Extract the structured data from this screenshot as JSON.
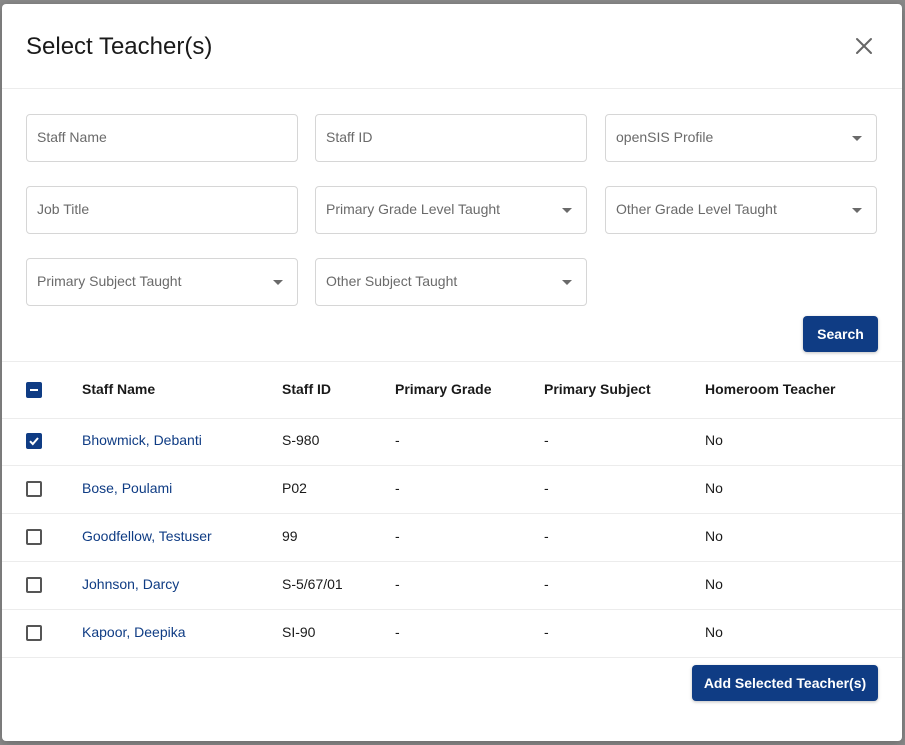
{
  "dialog": {
    "title": "Select Teacher(s)"
  },
  "filters": {
    "staff_name": "Staff Name",
    "staff_id": "Staff ID",
    "opensis_profile": "openSIS Profile",
    "job_title": "Job Title",
    "primary_grade": "Primary Grade Level Taught",
    "other_grade": "Other Grade Level Taught",
    "primary_subject": "Primary Subject Taught",
    "other_subject": "Other Subject Taught"
  },
  "search_label": "Search",
  "table": {
    "headers": {
      "staff_name": "Staff Name",
      "staff_id": "Staff ID",
      "primary_grade": "Primary Grade",
      "primary_subject": "Primary Subject",
      "homeroom": "Homeroom Teacher"
    },
    "rows": [
      {
        "name": "Bhowmick, Debanti",
        "id": "S-980",
        "grade": "-",
        "subject": "-",
        "homeroom": "No",
        "checked": true
      },
      {
        "name": "Bose, Poulami",
        "id": "P02",
        "grade": "-",
        "subject": "-",
        "homeroom": "No",
        "checked": false
      },
      {
        "name": "Goodfellow, Testuser",
        "id": "99",
        "grade": "-",
        "subject": "-",
        "homeroom": "No",
        "checked": false
      },
      {
        "name": "Johnson, Darcy",
        "id": "S-5/67/01",
        "grade": "-",
        "subject": "-",
        "homeroom": "No",
        "checked": false
      },
      {
        "name": "Kapoor, Deepika",
        "id": "SI-90",
        "grade": "-",
        "subject": "-",
        "homeroom": "No",
        "checked": false
      }
    ]
  },
  "add_label": "Add Selected Teacher(s)",
  "colors": {
    "primary": "#0f3c84",
    "border": "#d6d6d6",
    "link": "#0f3c84"
  }
}
